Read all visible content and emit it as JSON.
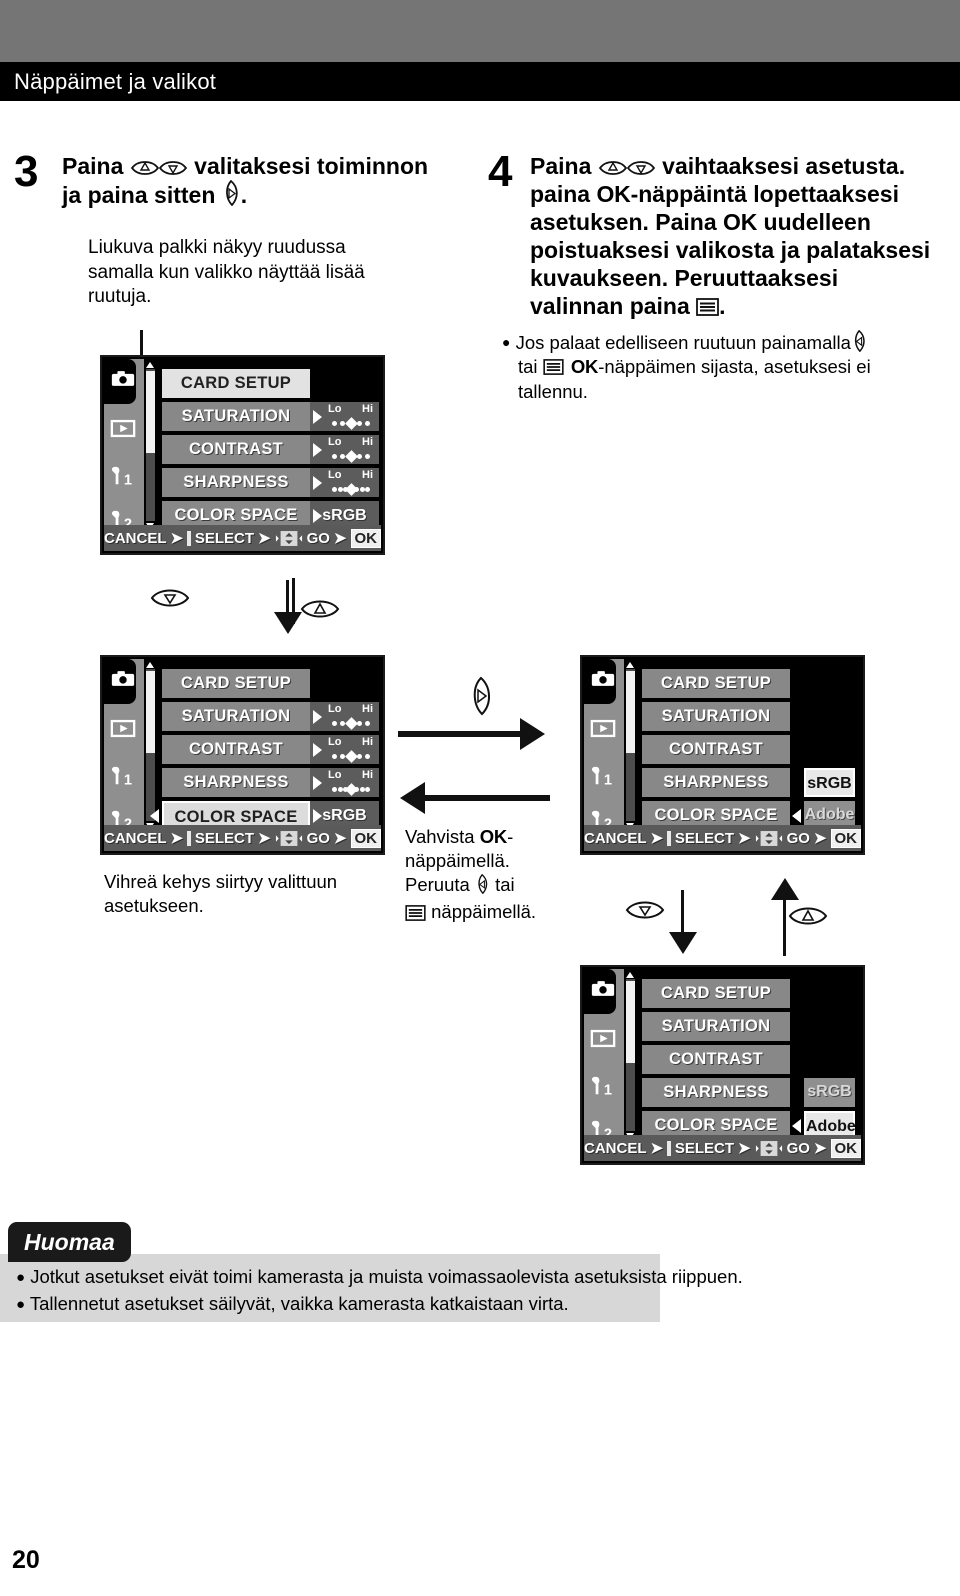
{
  "header": {
    "title": "Näppäimet ja valikot"
  },
  "page": {
    "number": "20"
  },
  "steps": [
    {
      "num": "3",
      "heading_a": "Paina",
      "heading_b": "valitaksesi toiminnon",
      "heading_c": "ja paina sitten",
      "heading_d": ".",
      "sub": "Liukuva palkki näkyy ruudussa samalla kun valikko näyttää lisää ruutuja."
    },
    {
      "num": "4",
      "heading_a": "Paina",
      "heading_b": "vaihtaaksesi asetusta.",
      "line2_pre": "paina ",
      "line2_ok": "OK",
      "line2_post": "-näppäintä lopettaaksesi",
      "line3_pre": "asetuksen. Paina ",
      "line3_ok": "OK",
      "line3_post": " uudelleen",
      "line4": "poistuaksesi valikosta ja palataksesi",
      "line5": "kuvaukseen. Peruuttaaksesi",
      "line6_pre": "valinnan paina ",
      "line6_post": ".",
      "bullet_1a": "Jos palaat edelliseen ruutuun painamalla",
      "bullet_1b": "tai",
      "bullet_1c": "OK",
      "bullet_1d": "-näppäimen sijasta, asetuksesi ei",
      "bullet_1e": "tallennu."
    }
  ],
  "captions": {
    "left_under_screen2": "Vihreä kehys siirtyy valittuun asetukseen.",
    "middle_1_pre": "Vahvista ",
    "middle_1_ok": "OK",
    "middle_1_post": "-",
    "middle_2": "näppäimellä.",
    "middle_3_pre": "Peruuta ",
    "middle_3_post": " tai",
    "middle_4": " näppäimellä."
  },
  "lcd_common": {
    "rail_icons": [
      "camera-icon",
      "playback-icon",
      "wrench-1-icon",
      "wrench-2-icon"
    ],
    "rail_labels": [
      "",
      "",
      "1",
      "2"
    ],
    "bottom_bar": {
      "cancel": "CANCEL",
      "select": "SELECT",
      "go": "GO",
      "ok": "OK"
    }
  },
  "screens": [
    {
      "id": "screen-1",
      "rows": [
        {
          "label": "CARD SETUP",
          "style": "white",
          "value_type": "none"
        },
        {
          "label": "SATURATION",
          "style": "normal",
          "value_type": "scale",
          "lo": "Lo",
          "hi": "Hi",
          "dots": 5,
          "marker": 2
        },
        {
          "label": "CONTRAST",
          "style": "normal",
          "value_type": "scale",
          "lo": "Lo",
          "hi": "Hi",
          "dots": 5,
          "marker": 2
        },
        {
          "label": "SHARPNESS",
          "style": "normal",
          "value_type": "scale",
          "lo": "Lo",
          "hi": "Hi",
          "dots": 7,
          "marker": 3
        },
        {
          "label": "COLOR SPACE",
          "style": "normal",
          "value_type": "text",
          "value": "sRGB"
        }
      ]
    },
    {
      "id": "screen-2",
      "rows": [
        {
          "label": "CARD SETUP",
          "style": "normal",
          "value_type": "none"
        },
        {
          "label": "SATURATION",
          "style": "normal",
          "value_type": "scale",
          "lo": "Lo",
          "hi": "Hi",
          "dots": 5,
          "marker": 2
        },
        {
          "label": "CONTRAST",
          "style": "normal",
          "value_type": "scale",
          "lo": "Lo",
          "hi": "Hi",
          "dots": 5,
          "marker": 2
        },
        {
          "label": "SHARPNESS",
          "style": "normal",
          "value_type": "scale",
          "lo": "Lo",
          "hi": "Hi",
          "dots": 7,
          "marker": 3
        },
        {
          "label": "COLOR SPACE",
          "style": "selected",
          "value_type": "text",
          "value": "sRGB"
        }
      ]
    },
    {
      "id": "screen-3",
      "rows": [
        {
          "label": "CARD SETUP",
          "style": "normal",
          "value_type": "none"
        },
        {
          "label": "SATURATION",
          "style": "normal",
          "value_type": "none"
        },
        {
          "label": "CONTRAST",
          "style": "normal",
          "value_type": "none"
        },
        {
          "label": "SHARPNESS",
          "style": "normal",
          "value_type": "option",
          "value": "sRGB",
          "option_state": "on"
        },
        {
          "label": "COLOR SPACE",
          "style": "normal",
          "value_type": "option",
          "value": "Adobe RGB",
          "option_state": "off"
        }
      ]
    },
    {
      "id": "screen-4",
      "rows": [
        {
          "label": "CARD SETUP",
          "style": "normal",
          "value_type": "none"
        },
        {
          "label": "SATURATION",
          "style": "normal",
          "value_type": "none"
        },
        {
          "label": "CONTRAST",
          "style": "normal",
          "value_type": "none"
        },
        {
          "label": "SHARPNESS",
          "style": "normal",
          "value_type": "option",
          "value": "sRGB",
          "option_state": "off"
        },
        {
          "label": "COLOR SPACE",
          "style": "normal",
          "value_type": "option",
          "value": "Adobe RGB",
          "option_state": "on"
        }
      ]
    }
  ],
  "note": {
    "tab": "Huomaa",
    "bullets": [
      "Jotkut asetukset eivät toimi kamerasta ja muista voimassaolevista asetuksista riippuen.",
      "Tallennetut asetukset säilyvät, vaikka kamerasta katkaistaan virta."
    ]
  },
  "colors": {
    "top_gray": "#757575",
    "header_black": "#000000",
    "note_gray": "#d7d7d7",
    "lcd_black": "#000000",
    "lcd_label_gray": "#888888",
    "lcd_value_gray": "#5c5c5c"
  }
}
